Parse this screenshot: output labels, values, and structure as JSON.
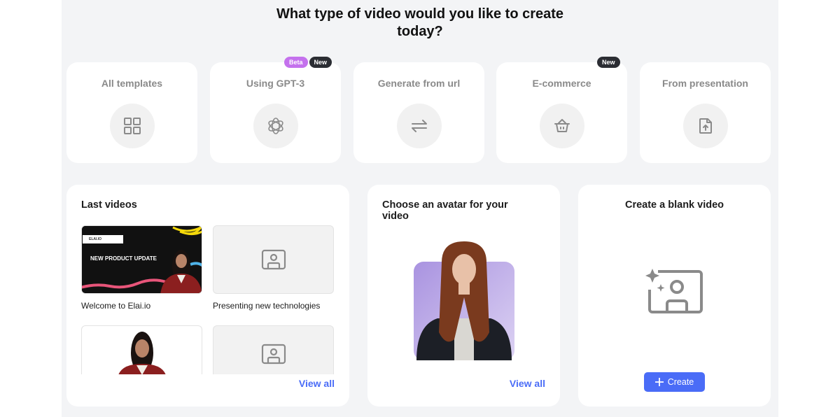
{
  "page": {
    "title_line1": "What type of video would you like to create",
    "title_line2": "today?"
  },
  "video_types": [
    {
      "label": "All templates",
      "icon": "grid-icon",
      "badges": []
    },
    {
      "label": "Using GPT-3",
      "icon": "openai-icon",
      "badges": [
        "Beta",
        "New"
      ]
    },
    {
      "label": "Generate from url",
      "icon": "arrows-exchange-icon",
      "badges": []
    },
    {
      "label": "E-commerce",
      "icon": "basket-icon",
      "badges": [
        "New"
      ]
    },
    {
      "label": "From presentation",
      "icon": "file-upload-icon",
      "badges": []
    }
  ],
  "last_videos": {
    "title": "Last videos",
    "items": [
      {
        "caption": "Welcome to Elai.io",
        "thumb_brand": "ELAI.IO",
        "thumb_headline": "NEW PRODUCT UPDATE"
      },
      {
        "caption": "Presenting new technologies"
      },
      {
        "caption": ""
      },
      {
        "caption": ""
      }
    ],
    "view_all": "View all"
  },
  "avatar_panel": {
    "title": "Choose an avatar for your video",
    "view_all": "View all"
  },
  "blank_panel": {
    "title": "Create a blank video",
    "create_label": "Create",
    "accent": "#4a6cf7"
  }
}
